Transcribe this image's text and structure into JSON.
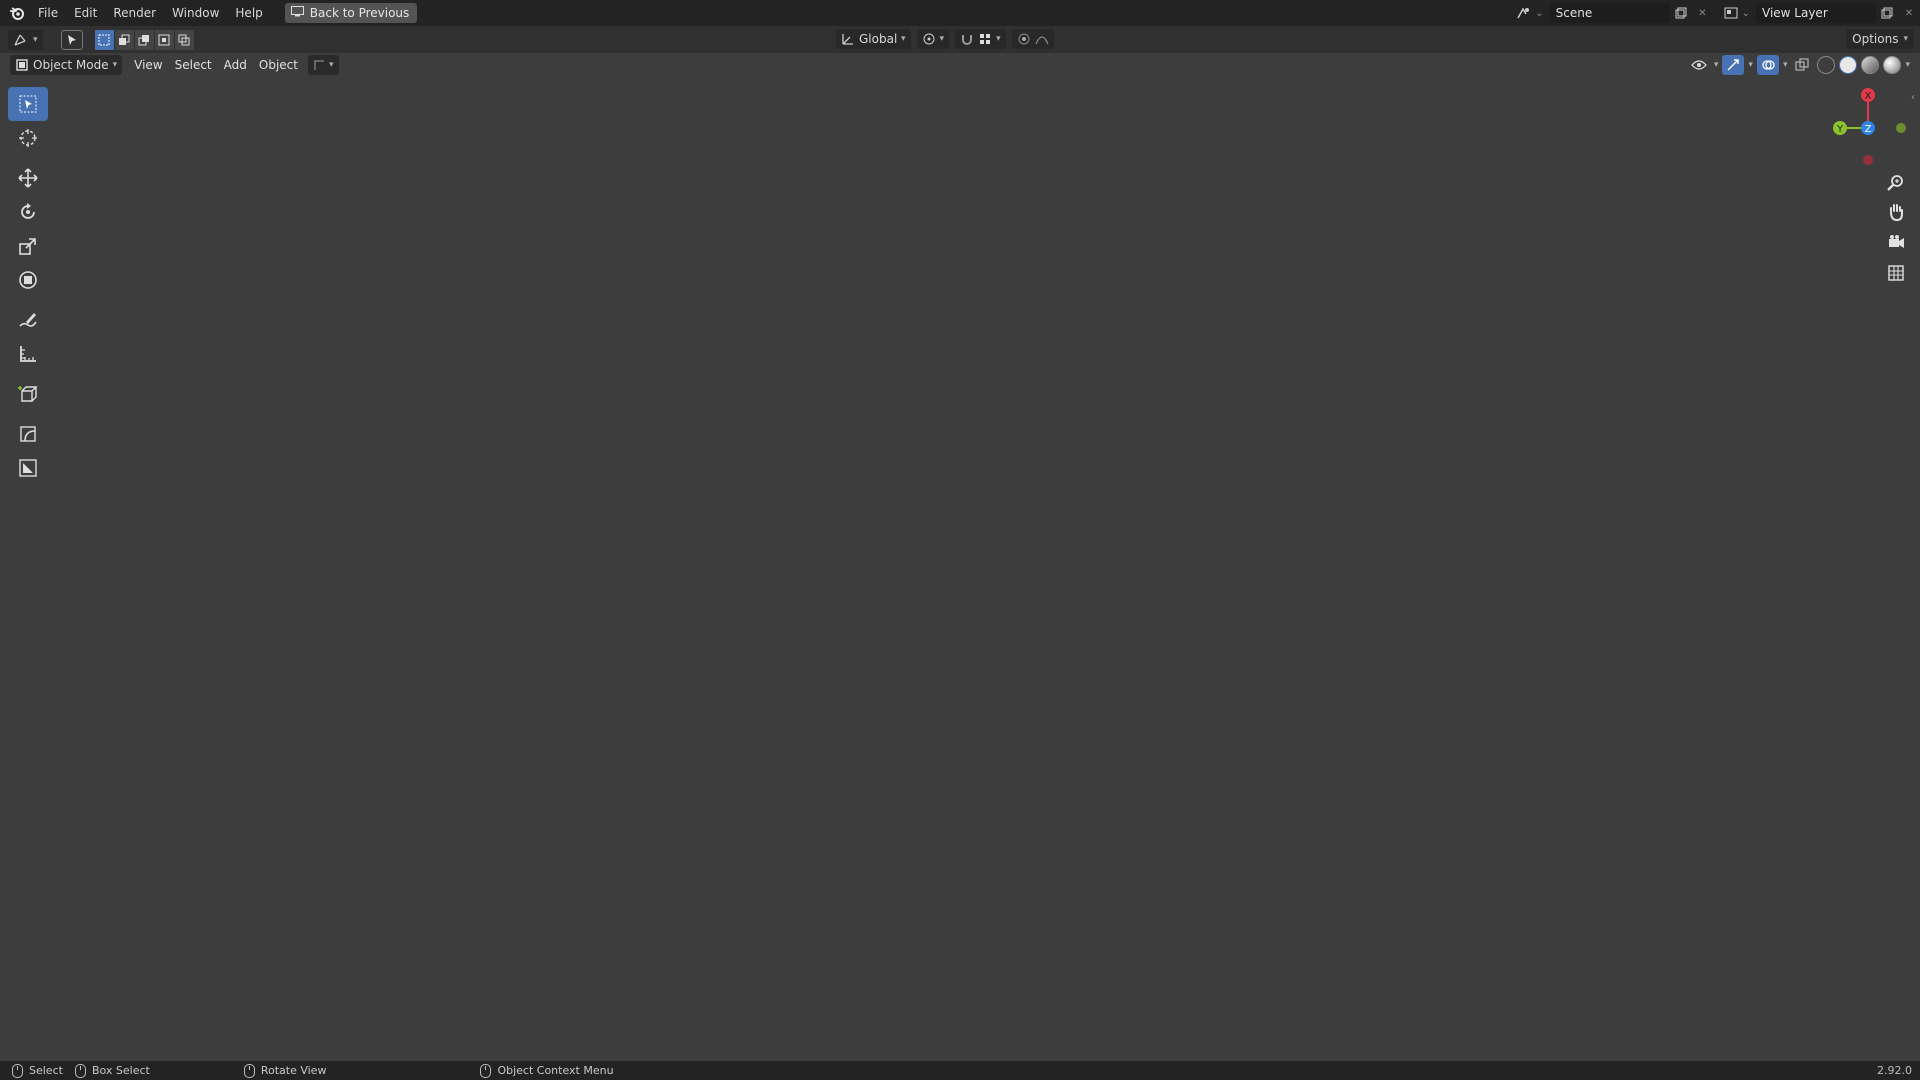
{
  "menu": {
    "items": [
      "File",
      "Edit",
      "Render",
      "Window",
      "Help"
    ],
    "back_button": "Back to Previous"
  },
  "top_right": {
    "scene": "Scene",
    "view_layer": "View Layer"
  },
  "tool_settings": {
    "orientation": "Global",
    "options": "Options"
  },
  "viewport_header": {
    "mode": "Object Mode",
    "view": "View",
    "select": "Select",
    "add": "Add",
    "object": "Object"
  },
  "gizmo": {
    "x": "X",
    "y": "Y",
    "z": "Z",
    "colors": {
      "x": "#e2394b",
      "y": "#8bc22b",
      "z": "#2f83e2"
    }
  },
  "status": {
    "select": "Select",
    "box_select": "Box Select",
    "rotate_view": "Rotate View",
    "context_menu": "Object Context Menu",
    "version": "2.92.0"
  },
  "colors": {
    "accent": "#4772b3",
    "viewport_bg": "#3d3d3d",
    "header_bg": "#232323"
  },
  "icons": {
    "left_toolbar": [
      "select-box-icon",
      "cursor-icon",
      "move-icon",
      "rotate-icon",
      "scale-icon",
      "transform-icon",
      "annotate-icon",
      "measure-icon",
      "add-cube-icon",
      "shear-icon",
      "edit-icon"
    ],
    "nav": [
      "zoom-icon",
      "pan-hand-icon",
      "camera-icon",
      "grid-ortho-icon"
    ]
  }
}
